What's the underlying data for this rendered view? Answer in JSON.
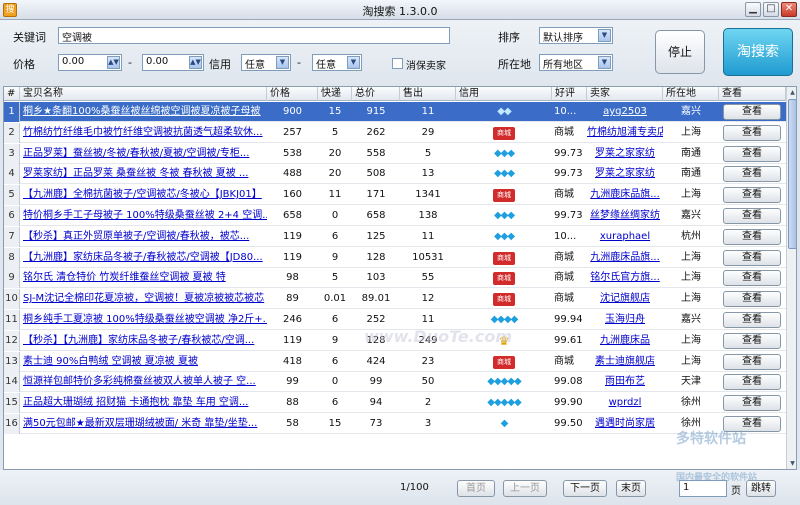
{
  "window": {
    "title": "淘搜索  1.3.0.0",
    "icon_glyph": "搜"
  },
  "toolbar": {
    "keyword_label": "关键词",
    "keyword_value": "空调被",
    "price_label": "价格",
    "price_min": "0.00",
    "price_max": "0.00",
    "dash": "-",
    "credit_label": "信用",
    "credit_min": "任意",
    "credit_max": "任意",
    "consumer_protect_label": "消保卖家",
    "sort_label": "排序",
    "sort_value": "默认排序",
    "location_label": "所在地",
    "location_value": "所有地区",
    "stop_label": "停止",
    "search_label": "淘搜索"
  },
  "columns": [
    "#",
    "宝贝名称",
    "价格",
    "快递",
    "总价",
    "售出",
    "信用",
    "好评",
    "卖家",
    "所在地",
    "查看"
  ],
  "view_label": "查看",
  "rows": [
    {
      "n": "1",
      "name": "桐乡★条翻100%桑蚕丝被丝绵被空调被夏凉被子母被",
      "price": "900",
      "ship": "15",
      "total": "915",
      "sold": "11",
      "credit": "◆◆",
      "credit_type": "gem",
      "rate": "10...",
      "seller": "ayg2503",
      "loc": "嘉兴",
      "selected": true
    },
    {
      "n": "2",
      "name": "竹棉纺竹纤维毛巾被竹纤维空调被抗菌透气超柔软休...",
      "price": "257",
      "ship": "5",
      "total": "262",
      "sold": "29",
      "credit": "商城",
      "credit_type": "mall",
      "rate": "商城",
      "seller": "竹棉纺旭浦专卖店",
      "loc": "上海"
    },
    {
      "n": "3",
      "name": "正品罗莱】蚕丝被/冬被/春秋被/夏被/空调被/专柜...",
      "price": "538",
      "ship": "20",
      "total": "558",
      "sold": "5",
      "credit": "◆◆◆",
      "credit_type": "gem",
      "rate": "99.73",
      "seller": "罗莱之家家纺",
      "loc": "南通"
    },
    {
      "n": "4",
      "name": "罗莱家纺】正品罗莱 桑蚕丝被 冬被 春秋被 夏被 ...",
      "price": "488",
      "ship": "20",
      "total": "508",
      "sold": "13",
      "credit": "◆◆◆",
      "credit_type": "gem",
      "rate": "99.73",
      "seller": "罗莱之家家纺",
      "loc": "南通"
    },
    {
      "n": "5",
      "name": "【九洲鹿】全棉抗菌被子/空调被芯/冬被心【JBKJ01】",
      "price": "160",
      "ship": "11",
      "total": "171",
      "sold": "1341",
      "credit": "商城",
      "credit_type": "mall",
      "rate": "商城",
      "seller": "九洲鹿床品旗...",
      "loc": "上海"
    },
    {
      "n": "6",
      "name": "特价桐乡手工子母被子 100%特级桑蚕丝被 2+4 空调...",
      "price": "658",
      "ship": "0",
      "total": "658",
      "sold": "138",
      "credit": "◆◆◆",
      "credit_type": "gem",
      "rate": "99.73",
      "seller": "丝梦缘丝绸家纺",
      "loc": "嘉兴"
    },
    {
      "n": "7",
      "name": "【秒杀】真正外贸原单被子/空调被/春秋被，被芯...",
      "price": "119",
      "ship": "6",
      "total": "125",
      "sold": "11",
      "credit": "◆◆◆",
      "credit_type": "gem",
      "rate": "10...",
      "seller": "xuraphael",
      "loc": "杭州"
    },
    {
      "n": "8",
      "name": "【九洲鹿】家纺床品冬被子/春秋被芯/空调被【JD80...",
      "price": "119",
      "ship": "9",
      "total": "128",
      "sold": "10531",
      "credit": "商城",
      "credit_type": "mall",
      "rate": "商城",
      "seller": "九洲鹿床品旗...",
      "loc": "上海"
    },
    {
      "n": "9",
      "name": "铭尔氏 清仓特价 竹炭纤维蚕丝空调被 夏被 特",
      "price": "98",
      "ship": "5",
      "total": "103",
      "sold": "55",
      "credit": "商城",
      "credit_type": "mall",
      "rate": "商城",
      "seller": "铭尔氏官方旗...",
      "loc": "上海"
    },
    {
      "n": "10",
      "name": "SJ-M沈记全棉印花夏凉被，空调被！夏被凉被被芯被芯",
      "price": "89",
      "ship": "0.01",
      "total": "89.01",
      "sold": "12",
      "credit": "商城",
      "credit_type": "mall",
      "rate": "商城",
      "seller": "沈记旗舰店",
      "loc": "上海"
    },
    {
      "n": "11",
      "name": "桐乡纯手工夏凉被 100%特级桑蚕丝被空调被 净2斤+...",
      "price": "246",
      "ship": "6",
      "total": "252",
      "sold": "11",
      "credit": "◆◆◆◆",
      "credit_type": "gem",
      "rate": "99.94",
      "seller": "玉海归舟",
      "loc": "嘉兴"
    },
    {
      "n": "12",
      "name": "【秒杀】【九洲鹿】家纺床品冬被子/春秋被芯/空调...",
      "price": "119",
      "ship": "9",
      "total": "128",
      "sold": "249",
      "credit": "♛",
      "credit_type": "crown",
      "rate": "99.61",
      "seller": "九洲鹿床品",
      "loc": "上海"
    },
    {
      "n": "13",
      "name": "素士迪 90%白鸭绒 空调被 夏凉被 夏被",
      "price": "418",
      "ship": "6",
      "total": "424",
      "sold": "23",
      "credit": "商城",
      "credit_type": "mall",
      "rate": "商城",
      "seller": "素士迪旗舰店",
      "loc": "上海"
    },
    {
      "n": "14",
      "name": "恒源祥包邮特价多彩纯棉蚕丝被双人被单人被子 空...",
      "price": "99",
      "ship": "0",
      "total": "99",
      "sold": "50",
      "credit": "◆◆◆◆◆",
      "credit_type": "gem",
      "rate": "99.08",
      "seller": "雨田布艺",
      "loc": "天津"
    },
    {
      "n": "15",
      "name": "正品超大珊瑚绒 招财猫 卡通抱枕 靠垫 车用 空调...",
      "price": "88",
      "ship": "6",
      "total": "94",
      "sold": "2",
      "credit": "◆◆◆◆◆",
      "credit_type": "gem",
      "rate": "99.90",
      "seller": "wprdzl",
      "loc": "徐州"
    },
    {
      "n": "16",
      "name": "满50元包邮★最新双层珊瑚绒被面/ 米奇 靠垫/坐垫...",
      "price": "58",
      "ship": "15",
      "total": "73",
      "sold": "3",
      "credit": "◆",
      "credit_type": "gem",
      "rate": "99.50",
      "seller": "遇遇时尚家居",
      "loc": "徐州"
    }
  ],
  "footer": {
    "page_info": "1/100",
    "first_page": "首页",
    "prev_page": "上一页",
    "next_page": "下一页",
    "last_page": "末页",
    "page_input": "1",
    "page_unit": "页",
    "jump_label": "跳转"
  },
  "watermarks": {
    "corner": "多特软件站",
    "corner_sub": "国内最安全的软件站",
    "center": "www.DuoTe.com"
  }
}
